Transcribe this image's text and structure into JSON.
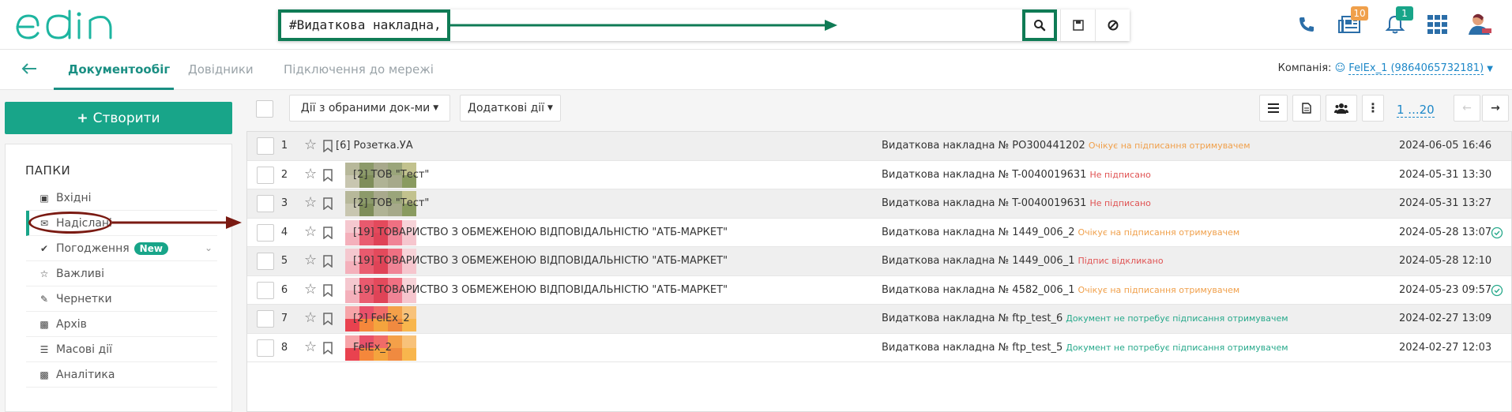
{
  "app": {
    "logo_text": "edin"
  },
  "search": {
    "value": "#Видаткова накладна,"
  },
  "header": {
    "newspaper_badge": "10",
    "bell_badge": "1"
  },
  "subnav": {
    "tabs": [
      {
        "label": "Документообіг"
      },
      {
        "label": "Довідники"
      },
      {
        "label": "Підключення до мережі"
      }
    ],
    "company_label": "Компанія:",
    "company_value": "FelEx_1 (9864065732181)"
  },
  "sidebar": {
    "create_label": "Створити",
    "folders_title": "ПАПКИ",
    "items": [
      {
        "label": "Вхідні",
        "icon": "inbox-icon"
      },
      {
        "label": "Надіслані",
        "icon": "envelope-icon"
      },
      {
        "label": "Погодження",
        "icon": "check-icon",
        "badge": "New"
      },
      {
        "label": "Важливі",
        "icon": "star-icon"
      },
      {
        "label": "Чернетки",
        "icon": "draft-icon"
      },
      {
        "label": "Архів",
        "icon": "archive-icon"
      },
      {
        "label": "Масові дії",
        "icon": "bulk-icon"
      },
      {
        "label": "Аналітика",
        "icon": "chart-icon"
      }
    ]
  },
  "toolbar": {
    "actions_selected_label": "Дії з обраними док-ми",
    "additional_actions_label": "Додаткові дії",
    "pager_label": "1 ...20"
  },
  "colors": {
    "accent": "#18a589",
    "annotation_green": "#0f7b55",
    "annotation_red": "#7a1a12",
    "status_orange": "#f0a04b",
    "status_red": "#e05353",
    "status_green": "#27a98b"
  },
  "documents": [
    {
      "num": "1",
      "party": "[6] Розетка.УА",
      "doc": "Видаткова накладна № PO300441202",
      "status": "Очікує на підписання отримувачем",
      "status_color": "#f0a04b",
      "date": "2024-06-05 16:46",
      "thumb": "none",
      "ok": false
    },
    {
      "num": "2",
      "party": "[2] ТОВ \"Тест\"",
      "doc": "Видаткова накладна № T-0040019631",
      "status": "Не підписано",
      "status_color": "#e05353",
      "date": "2024-05-31 13:30",
      "thumb": "olive",
      "ok": false
    },
    {
      "num": "3",
      "party": "[2] ТОВ \"Тест\"",
      "doc": "Видаткова накладна № T-0040019631",
      "status": "Не підписано",
      "status_color": "#e05353",
      "date": "2024-05-31 13:27",
      "thumb": "olive",
      "ok": false
    },
    {
      "num": "4",
      "party": "[19] ТОВАРИСТВО З ОБМЕЖЕНОЮ ВІДПОВІДАЛЬНІСТЮ \"АТБ-МАРКЕТ\"",
      "doc": "Видаткова накладна № 1449_006_2",
      "status": "Очікує на підписання отримувачем",
      "status_color": "#f0a04b",
      "date": "2024-05-28 13:07",
      "thumb": "red",
      "ok": true
    },
    {
      "num": "5",
      "party": "[19] ТОВАРИСТВО З ОБМЕЖЕНОЮ ВІДПОВІДАЛЬНІСТЮ \"АТБ-МАРКЕТ\"",
      "doc": "Видаткова накладна № 1449_006_1",
      "status": "Підпис відкликано",
      "status_color": "#e05353",
      "date": "2024-05-28 12:10",
      "thumb": "red",
      "ok": false
    },
    {
      "num": "6",
      "party": "[19] ТОВАРИСТВО З ОБМЕЖЕНОЮ ВІДПОВІДАЛЬНІСТЮ \"АТБ-МАРКЕТ\"",
      "doc": "Видаткова накладна № 4582_006_1",
      "status": "Очікує на підписання отримувачем",
      "status_color": "#f0a04b",
      "date": "2024-05-23 09:57",
      "thumb": "red",
      "ok": true
    },
    {
      "num": "7",
      "party": "[2] FelEx_2",
      "doc": "Видаткова накладна № ftp_test_6",
      "status": "Документ не потребує підписання отримувачем",
      "status_color": "#27a98b",
      "date": "2024-02-27 13:09",
      "thumb": "orange",
      "ok": false
    },
    {
      "num": "8",
      "party": "FelEx_2",
      "doc": "Видаткова накладна № ftp_test_5",
      "status": "Документ не потребує підписання отримувачем",
      "status_color": "#27a98b",
      "date": "2024-02-27 12:03",
      "thumb": "orange",
      "ok": false
    }
  ]
}
